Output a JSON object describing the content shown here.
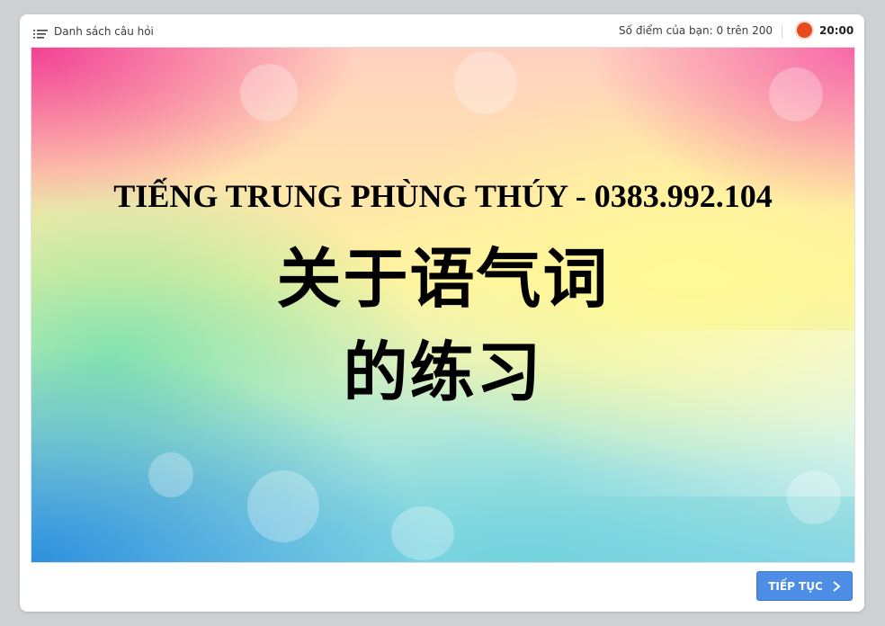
{
  "topbar": {
    "question_list_label": "Danh sách câu hỏi",
    "question_list_icon": "list-icon",
    "score_text": "Số điểm của bạn: 0 trên 200",
    "timer_text": "20:00",
    "timer_color": "#e84b1f"
  },
  "slide": {
    "line1": "TIẾNG TRUNG PHÙNG THÚY - 0383.992.104",
    "line2": "关于语气词",
    "line3": "的练习"
  },
  "footer": {
    "next_label": "TIẾP TỤC",
    "next_icon": "chevron-right-icon",
    "accent_color": "#4d8de6"
  }
}
